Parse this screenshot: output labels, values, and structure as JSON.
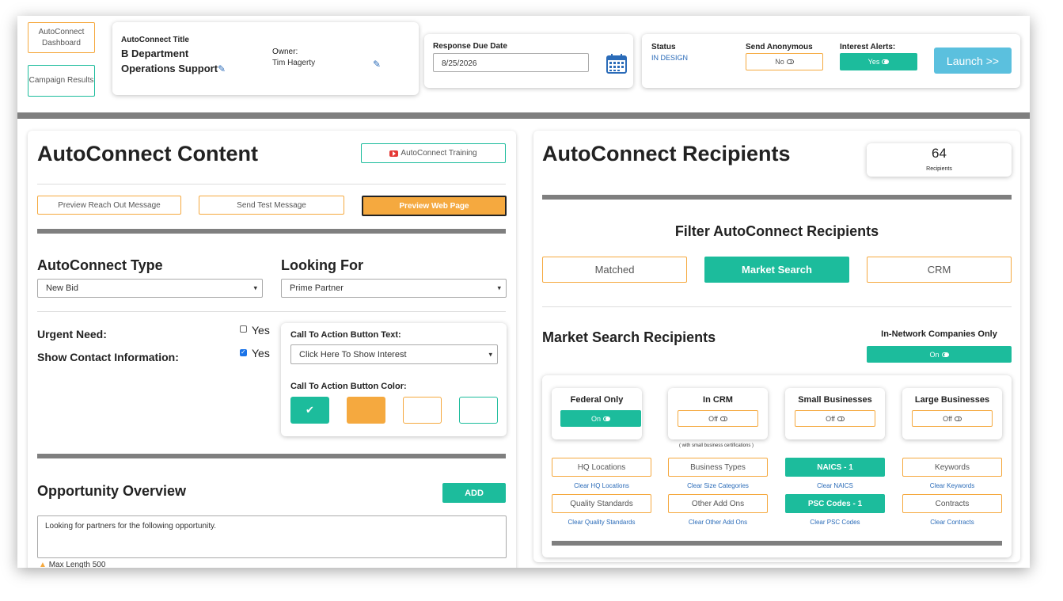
{
  "header": {
    "nav_dashboard": "AutoConnect Dashboard",
    "nav_campaign": "Campaign Results",
    "title_label": "AutoConnect Title",
    "title_value_line1": "B Department",
    "title_value_line2": "Operations Support",
    "owner_label": "Owner:",
    "owner_value": "Tim Hagerty",
    "due_label": "Response Due Date",
    "due_value": "8/25/2026",
    "status_label": "Status",
    "status_value": "IN DESIGN",
    "anon_label": "Send Anonymous",
    "anon_value": "No",
    "alerts_label": "Interest Alerts:",
    "alerts_value": "Yes",
    "launch_label": "Launch >>"
  },
  "content": {
    "title": "AutoConnect Content",
    "training_label": "AutoConnect Training",
    "preview_reach": "Preview Reach Out Message",
    "send_test": "Send Test Message",
    "preview_web": "Preview Web Page",
    "type_label": "AutoConnect Type",
    "type_value": "New Bid",
    "looking_label": "Looking For",
    "looking_value": "Prime Partner",
    "urgent_label": "Urgent Need:",
    "urgent_yes": "Yes",
    "contact_label": "Show Contact Information:",
    "contact_yes": "Yes",
    "cta_text_label": "Call To Action Button Text:",
    "cta_text_value": "Click Here To Show Interest",
    "cta_color_label": "Call To Action Button Color:",
    "check_mark": "✔",
    "overview_title": "Opportunity Overview",
    "add_label": "ADD",
    "overview_text": "Looking for partners for the following opportunity.",
    "max_length": "Max Length 500"
  },
  "colors": {
    "teal": "#1cbc9c",
    "orange": "#f5a93f",
    "launch": "#5bc0de",
    "gray_bar": "#7f7f7f"
  },
  "recipients": {
    "title": "AutoConnect Recipients",
    "count": "64",
    "count_label": "Recipients",
    "filter_title": "Filter AutoConnect Recipients",
    "tab_matched": "Matched",
    "tab_market": "Market Search",
    "tab_crm": "CRM",
    "market_title": "Market Search Recipients",
    "in_network_label": "In-Network Companies Only",
    "in_network_value": "On",
    "federal_label": "Federal Only",
    "federal_value": "On",
    "crm_label": "In CRM",
    "crm_value": "Off",
    "small_label": "Small Businesses",
    "small_value": "Off",
    "small_note": "( with small business certifications )",
    "large_label": "Large Businesses",
    "large_value": "Off",
    "hq": "HQ Locations",
    "hq_clear": "Clear HQ Locations",
    "btypes": "Business Types",
    "btypes_clear": "Clear Size Categories",
    "naics": "NAICS - 1",
    "naics_clear": "Clear NAICS",
    "keywords": "Keywords",
    "keywords_clear": "Clear Keywords",
    "quality": "Quality Standards",
    "quality_clear": "Clear Quality Standards",
    "other": "Other Add Ons",
    "other_clear": "Clear Other Add Ons",
    "psc": "PSC Codes - 1",
    "psc_clear": "Clear PSC Codes",
    "contracts": "Contracts",
    "contracts_clear": "Clear Contracts"
  }
}
